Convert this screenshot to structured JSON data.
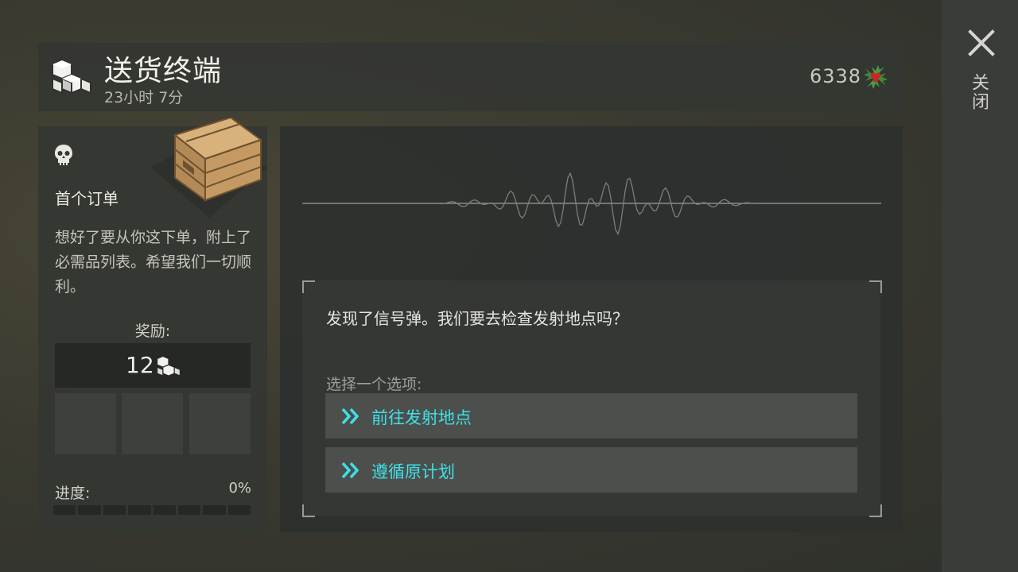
{
  "close": {
    "label": "关闭"
  },
  "header": {
    "title": "送货终端",
    "timer": "23小时 7分",
    "currency_amount": "6338"
  },
  "order": {
    "title": "首个订单",
    "description": "想好了要从你这下单，附上了必需品列表。希望我们一切顺利。",
    "reward_label": "奖励:",
    "reward_value": "12",
    "progress_label": "进度:",
    "progress_percent": "0%",
    "progress_value": 0
  },
  "dialog": {
    "question": "发现了信号弹。我们要去检查发射地点吗？",
    "choose_label": "选择一个选项:",
    "options": [
      {
        "label": "前往发射地点"
      },
      {
        "label": "遵循原计划"
      }
    ]
  },
  "colors": {
    "option_text": "#3ee0e8",
    "panel_bg": "#343632",
    "holly_leaf": "#3f8a3a",
    "holly_berry": "#c8282a"
  }
}
